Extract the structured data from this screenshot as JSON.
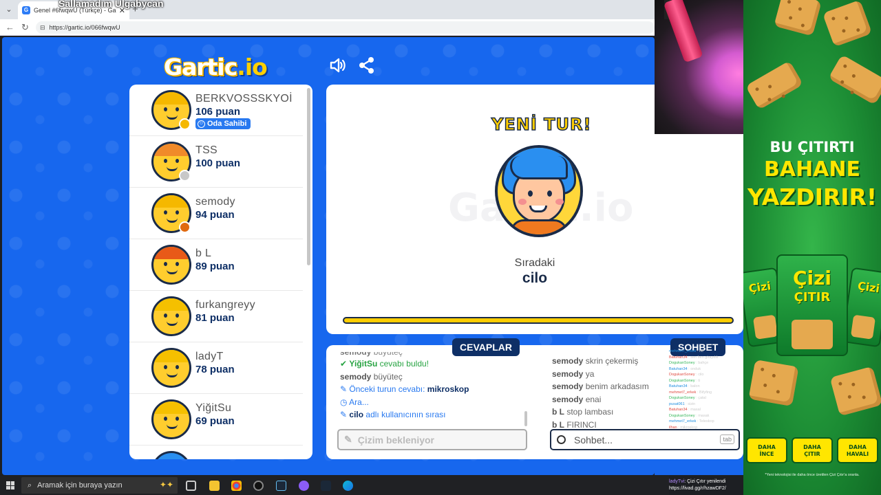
{
  "browser": {
    "tab_title": "Genel #6fwqwU (Türkçe) - Gartic.io",
    "url": "https://gartic.io/066fwqwU",
    "stream_overlay": "Sallamadım Ulgabycan",
    "favicon": "G"
  },
  "game": {
    "logo_main": "Gartic",
    "logo_io": ".io",
    "sound_icon": "speaker-icon",
    "share_icon": "share-icon"
  },
  "players": [
    {
      "name": "BERKVOSSSKYOİ",
      "points": "106 puan",
      "owner_badge": "Oda Sahibi",
      "status_color": "#f5b800",
      "hair": "#f5b800"
    },
    {
      "name": "TSS",
      "points": "100 puan",
      "status_color": "#c8c8c8",
      "hair": "#f08a2a"
    },
    {
      "name": "semody",
      "points": "94 puan",
      "status_color": "#e06a10",
      "hair": "#f5b800"
    },
    {
      "name": "b L",
      "points": "89 puan",
      "status_color": "",
      "hair": "#e85a18"
    },
    {
      "name": "furkangreyy",
      "points": "81 puan",
      "status_color": "",
      "hair": "#f5c000"
    },
    {
      "name": "ladyT",
      "points": "78 puan",
      "status_color": "",
      "hair": "#f5c000"
    },
    {
      "name": "YiğitSu",
      "points": "69 puan",
      "status_color": "",
      "hair": "#f5c000"
    }
  ],
  "stage": {
    "watermark": "Gartic.io",
    "new_round": "YENİ TUR!",
    "next_label": "Sıradaki",
    "next_player": "cilo",
    "timer_fraction": 1.0
  },
  "answers": {
    "header": "CEVAPLAR",
    "lines": [
      {
        "user": "semody",
        "text": "büyüteç",
        "kind": "partial"
      },
      {
        "user": "YiğitSu",
        "text": "cevabı buldu!",
        "kind": "found"
      },
      {
        "user": "semody",
        "text": "büyüteç",
        "kind": "normal"
      },
      {
        "user": "",
        "text": "Önceki turun cevabı:",
        "extra": "mikroskop",
        "kind": "info"
      },
      {
        "user": "",
        "text": "Ara...",
        "kind": "timer"
      },
      {
        "user": "cilo",
        "text": "adlı kullanıcının sırası",
        "kind": "turn"
      }
    ],
    "input_placeholder": "Çizim bekleniyor"
  },
  "chat": {
    "header": "SOHBET",
    "lines": [
      {
        "user": "semody",
        "text": "skrin çekermiş"
      },
      {
        "user": "semody",
        "text": "ya"
      },
      {
        "user": "semody",
        "text": "benim arkadasım"
      },
      {
        "user": "semody",
        "text": "enai"
      },
      {
        "user": "b L",
        "text": "stop lambası"
      },
      {
        "user": "b L",
        "text": "FIRINCI"
      }
    ],
    "input_placeholder": "Sohbet...",
    "tab_hint": "tab"
  },
  "stream_chat": {
    "lines": [
      {
        "user": "mehmet7_erkek",
        "text": "ne"
      },
      {
        "user": "Batuhan34",
        "text": "sen ben giraydık"
      },
      {
        "user": "DogukanSoney",
        "text": "bahçe"
      },
      {
        "user": "Batuhan34",
        "text": "onduk"
      },
      {
        "user": "DogukanSoney",
        "text": "cilo"
      },
      {
        "user": "DogukanSoney",
        "text": "ti"
      },
      {
        "user": "Batuhan34",
        "text": "balon"
      },
      {
        "user": "mehmet7_erkek",
        "text": "Bifyfing"
      },
      {
        "user": "DogukanSoney",
        "text": "çatal"
      },
      {
        "user": "pusat061",
        "text": "sizin"
      },
      {
        "user": "Batuhan34",
        "text": "masal"
      },
      {
        "user": "DogukanSoney",
        "text": "masak"
      },
      {
        "user": "mehmet7_erkek",
        "text": "Teleskop"
      },
      {
        "user": "ilhan",
        "text": "mikroskop"
      }
    ],
    "bottom_user": "ladyTvi",
    "bottom_text": "Çizi Çıtır yenilendi",
    "bottom_link": "https://livad.gg/r/hzawDF2/"
  },
  "ad": {
    "line1": "BU ÇITIRTI",
    "line2": "BAHANE",
    "line3": "YAZDIRIR!",
    "bag_brand": "Çizi",
    "bag_sub": "ÇITIR",
    "pills": [
      "DAHA\nİNCE",
      "DAHA\nÇITIR",
      "DAHA\nHAVALI"
    ],
    "footnote": "*Yeni teknolojisi ile daha önce üretilen Çizi Çıtır'a oranla."
  },
  "taskbar": {
    "search_placeholder": "Aramak için buraya yazın"
  }
}
